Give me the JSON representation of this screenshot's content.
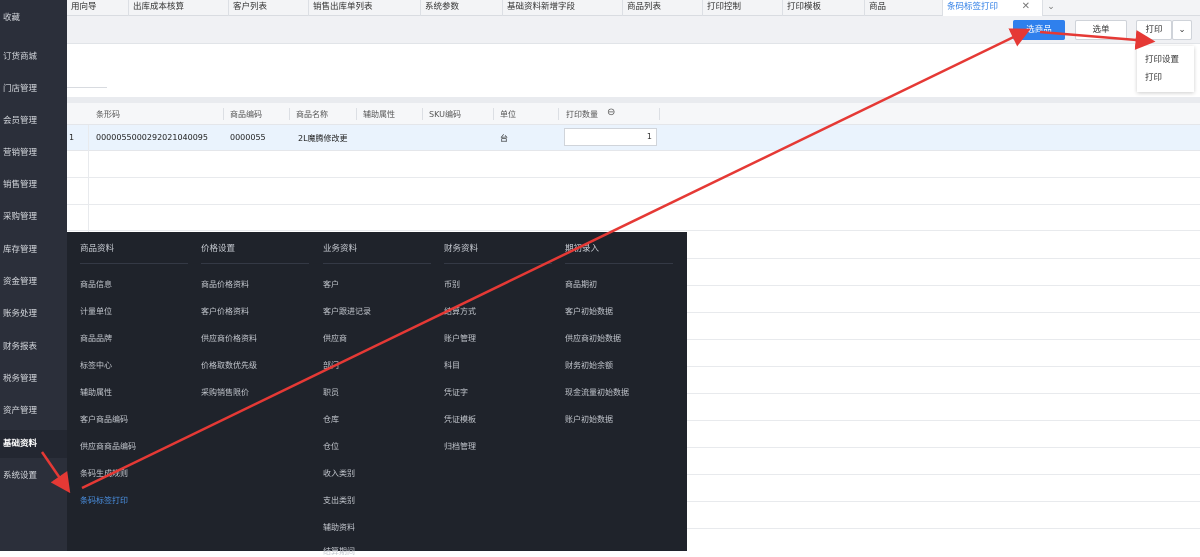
{
  "sidebar": {
    "items": [
      {
        "label": "收藏"
      },
      {
        "label": "订货商城"
      },
      {
        "label": "门店管理"
      },
      {
        "label": "会员管理"
      },
      {
        "label": "营销管理"
      },
      {
        "label": "销售管理"
      },
      {
        "label": "采购管理"
      },
      {
        "label": "库存管理"
      },
      {
        "label": "资金管理"
      },
      {
        "label": "账务处理"
      },
      {
        "label": "财务报表"
      },
      {
        "label": "税务管理"
      },
      {
        "label": "资产管理"
      },
      {
        "label": "基础资料"
      },
      {
        "label": "系统设置"
      }
    ]
  },
  "tabs": [
    {
      "label": "用向导"
    },
    {
      "label": "出库成本核算"
    },
    {
      "label": "客户列表"
    },
    {
      "label": "销售出库单列表"
    },
    {
      "label": "系统参数"
    },
    {
      "label": "基础资料新增字段"
    },
    {
      "label": "商品列表"
    },
    {
      "label": "打印控制"
    },
    {
      "label": "打印模板"
    },
    {
      "label": "商品"
    },
    {
      "label": "条码标签打印"
    }
  ],
  "toolbar": {
    "select_goods": "选商品",
    "select_doc": "选单",
    "print": "打印"
  },
  "print_menu": [
    "打印设置",
    "打印"
  ],
  "grid": {
    "headers": [
      "条形码",
      "商品编码",
      "商品名称",
      "辅助属性",
      "SKU编码",
      "单位",
      "打印数量"
    ],
    "rows": [
      {
        "index": "1",
        "barcode": "0000055000292021040095",
        "code": "0000055",
        "name": "2L魔腾修改更",
        "attr": "",
        "sku": "",
        "unit": "台",
        "qty": "1"
      }
    ]
  },
  "mega_menu": {
    "columns": [
      {
        "title": "商品资料",
        "items": [
          "商品信息",
          "计量单位",
          "商品品牌",
          "标签中心",
          "辅助属性",
          "客户商品编码",
          "供应商商品编码",
          "条码生成规则",
          "条码标签打印"
        ]
      },
      {
        "title": "价格设置",
        "items": [
          "商品价格资料",
          "客户价格资料",
          "供应商价格资料",
          "价格取数优先级",
          "采购销售限价"
        ]
      },
      {
        "title": "业务资料",
        "items": [
          "客户",
          "客户跟进记录",
          "供应商",
          "部门",
          "职员",
          "仓库",
          "仓位",
          "收入类别",
          "支出类别",
          "辅助资料",
          "结算期间"
        ]
      },
      {
        "title": "财务资料",
        "items": [
          "币别",
          "结算方式",
          "账户管理",
          "科目",
          "凭证字",
          "凭证模板",
          "归档管理"
        ]
      },
      {
        "title": "期初录入",
        "items": [
          "商品期初",
          "客户初始数据",
          "供应商初始数据",
          "财务初始余额",
          "现金流量初始数据",
          "账户初始数据"
        ]
      }
    ]
  },
  "colors": {
    "accent": "#2f80ed",
    "arrow": "#e53935",
    "menu_bg": "#1f232b",
    "sidebar_bg": "#2b2f3a"
  }
}
